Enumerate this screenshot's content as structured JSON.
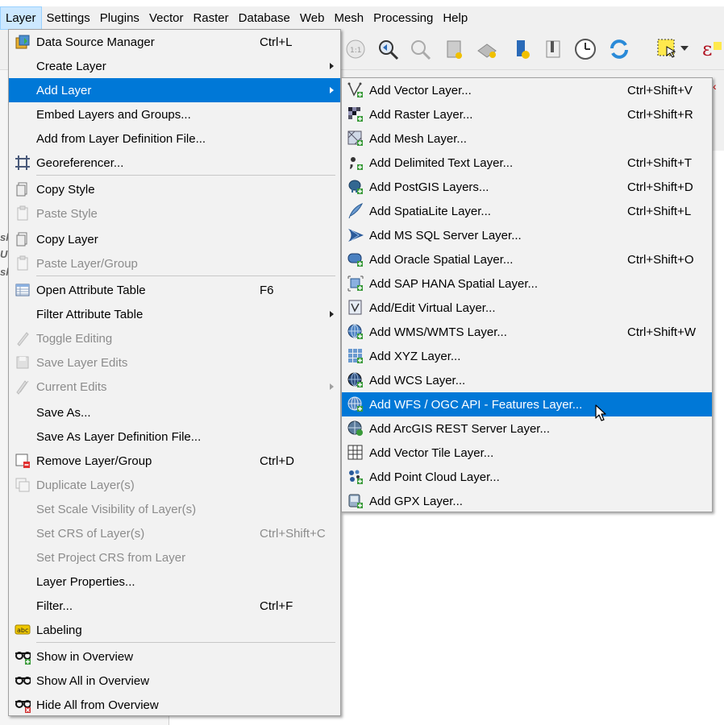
{
  "menubar": {
    "items": [
      "Layer",
      "Settings",
      "Plugins",
      "Vector",
      "Raster",
      "Database",
      "Web",
      "Mesh",
      "Processing",
      "Help"
    ],
    "active": "Layer"
  },
  "layer_menu": {
    "items": [
      {
        "label": "Data Source Manager",
        "shortcut": "Ctrl+L",
        "icon": "data-source-manager-icon",
        "enabled": true
      },
      {
        "label": "Create Layer",
        "submenu": true,
        "enabled": true
      },
      {
        "label": "Add Layer",
        "submenu": true,
        "highlighted": true,
        "enabled": true
      },
      {
        "label": "Embed Layers and Groups...",
        "enabled": true
      },
      {
        "label": "Add from Layer Definition File...",
        "enabled": true
      },
      {
        "label": "Georeferencer...",
        "icon": "georeferencer-icon",
        "enabled": true
      },
      {
        "label": "Copy Style",
        "icon": "copy-style-icon",
        "enabled": true
      },
      {
        "label": "Paste Style",
        "icon": "paste-style-icon",
        "enabled": false
      },
      {
        "label": "Copy Layer",
        "icon": "copy-layer-icon",
        "enabled": true
      },
      {
        "label": "Paste Layer/Group",
        "icon": "paste-layer-icon",
        "enabled": false
      },
      {
        "label": "Open Attribute Table",
        "shortcut": "F6",
        "icon": "attribute-table-icon",
        "enabled": true
      },
      {
        "label": "Filter Attribute Table",
        "submenu": true,
        "enabled": true
      },
      {
        "label": "Toggle Editing",
        "icon": "pencil-icon",
        "enabled": false
      },
      {
        "label": "Save Layer Edits",
        "icon": "save-edits-icon",
        "enabled": false
      },
      {
        "label": "Current Edits",
        "submenu": true,
        "icon": "current-edits-icon",
        "enabled": false
      },
      {
        "label": "Save As...",
        "enabled": true
      },
      {
        "label": "Save As Layer Definition File...",
        "enabled": true
      },
      {
        "label": "Remove Layer/Group",
        "shortcut": "Ctrl+D",
        "icon": "remove-layer-icon",
        "enabled": true
      },
      {
        "label": "Duplicate Layer(s)",
        "icon": "duplicate-layer-icon",
        "enabled": false
      },
      {
        "label": "Set Scale Visibility of Layer(s)",
        "enabled": false
      },
      {
        "label": "Set CRS of Layer(s)",
        "shortcut": "Ctrl+Shift+C",
        "enabled": false
      },
      {
        "label": "Set Project CRS from Layer",
        "enabled": false
      },
      {
        "label": "Layer Properties...",
        "enabled": true
      },
      {
        "label": "Filter...",
        "shortcut": "Ctrl+F",
        "enabled": true
      },
      {
        "label": "Labeling",
        "icon": "labeling-abc-icon",
        "enabled": true
      },
      {
        "label": "Show in Overview",
        "icon": "show-overview-icon",
        "enabled": true
      },
      {
        "label": "Show All in Overview",
        "icon": "show-all-overview-icon",
        "enabled": true
      },
      {
        "label": "Hide All from Overview",
        "icon": "hide-all-overview-icon",
        "enabled": true
      }
    ]
  },
  "add_layer_menu": {
    "items": [
      {
        "label": "Add Vector Layer...",
        "shortcut": "Ctrl+Shift+V",
        "icon": "vector-layer-icon"
      },
      {
        "label": "Add Raster Layer...",
        "shortcut": "Ctrl+Shift+R",
        "icon": "raster-layer-icon"
      },
      {
        "label": "Add Mesh Layer...",
        "icon": "mesh-layer-icon"
      },
      {
        "label": "Add Delimited Text Layer...",
        "shortcut": "Ctrl+Shift+T",
        "icon": "delimited-text-icon"
      },
      {
        "label": "Add PostGIS Layers...",
        "shortcut": "Ctrl+Shift+D",
        "icon": "postgis-elephant-icon"
      },
      {
        "label": "Add SpatiaLite Layer...",
        "shortcut": "Ctrl+Shift+L",
        "icon": "spatialite-feather-icon"
      },
      {
        "label": "Add MS SQL Server Layer...",
        "icon": "mssql-icon"
      },
      {
        "label": "Add Oracle Spatial Layer...",
        "shortcut": "Ctrl+Shift+O",
        "icon": "oracle-icon"
      },
      {
        "label": "Add SAP HANA Spatial Layer...",
        "icon": "sap-hana-icon"
      },
      {
        "label": "Add/Edit Virtual Layer...",
        "icon": "virtual-layer-icon"
      },
      {
        "label": "Add WMS/WMTS Layer...",
        "shortcut": "Ctrl+Shift+W",
        "icon": "wms-globe-icon"
      },
      {
        "label": "Add XYZ Layer...",
        "icon": "xyz-grid-icon"
      },
      {
        "label": "Add WCS Layer...",
        "icon": "wcs-globe-icon"
      },
      {
        "label": "Add WFS / OGC API - Features Layer...",
        "icon": "wfs-globe-icon",
        "highlighted": true
      },
      {
        "label": "Add ArcGIS REST Server Layer...",
        "icon": "arcgis-globe-icon"
      },
      {
        "label": "Add Vector Tile Layer...",
        "icon": "vector-tile-icon"
      },
      {
        "label": "Add Point Cloud Layer...",
        "icon": "point-cloud-icon"
      },
      {
        "label": "Add GPX Layer...",
        "icon": "gpx-icon"
      }
    ]
  },
  "colors": {
    "highlight": "#0078d7",
    "menubar_active": "#cce8ff",
    "disabled_text": "#8c8c8c"
  }
}
